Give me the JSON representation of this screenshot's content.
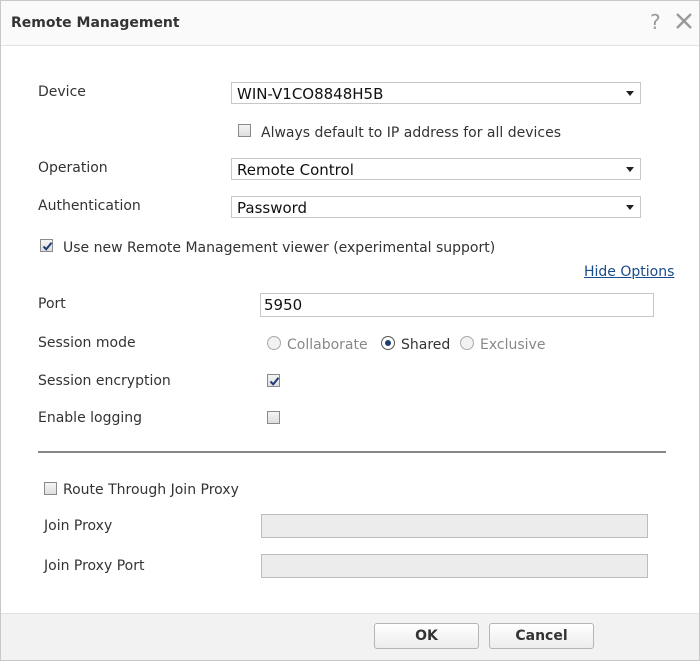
{
  "dialog": {
    "title": "Remote Management",
    "help_glyph": "?"
  },
  "form": {
    "device": {
      "label": "Device",
      "value": "WIN-V1CO8848H5B"
    },
    "always_default_ip": {
      "label": "Always default to IP address for all devices",
      "checked": false
    },
    "operation": {
      "label": "Operation",
      "value": "Remote Control"
    },
    "authentication": {
      "label": "Authentication",
      "value": "Password"
    },
    "use_new_viewer": {
      "label": "Use new Remote Management viewer (experimental support)",
      "checked": true
    },
    "hide_options": "Hide Options",
    "port": {
      "label": "Port",
      "value": "5950"
    },
    "session_mode": {
      "label": "Session mode",
      "options": [
        "Collaborate",
        "Shared",
        "Exclusive"
      ],
      "selected": "Shared"
    },
    "session_encryption": {
      "label": "Session encryption",
      "checked": true
    },
    "enable_logging": {
      "label": "Enable logging",
      "checked": false
    },
    "route_join_proxy": {
      "label": "Route Through Join Proxy",
      "checked": false
    },
    "join_proxy": {
      "label": "Join Proxy",
      "value": ""
    },
    "join_proxy_port": {
      "label": "Join Proxy Port",
      "value": ""
    }
  },
  "buttons": {
    "ok": "OK",
    "cancel": "Cancel"
  },
  "colors": {
    "link": "#1a4b8c",
    "radio_fill": "#1e3c72",
    "disabled_field": "#ececec"
  }
}
